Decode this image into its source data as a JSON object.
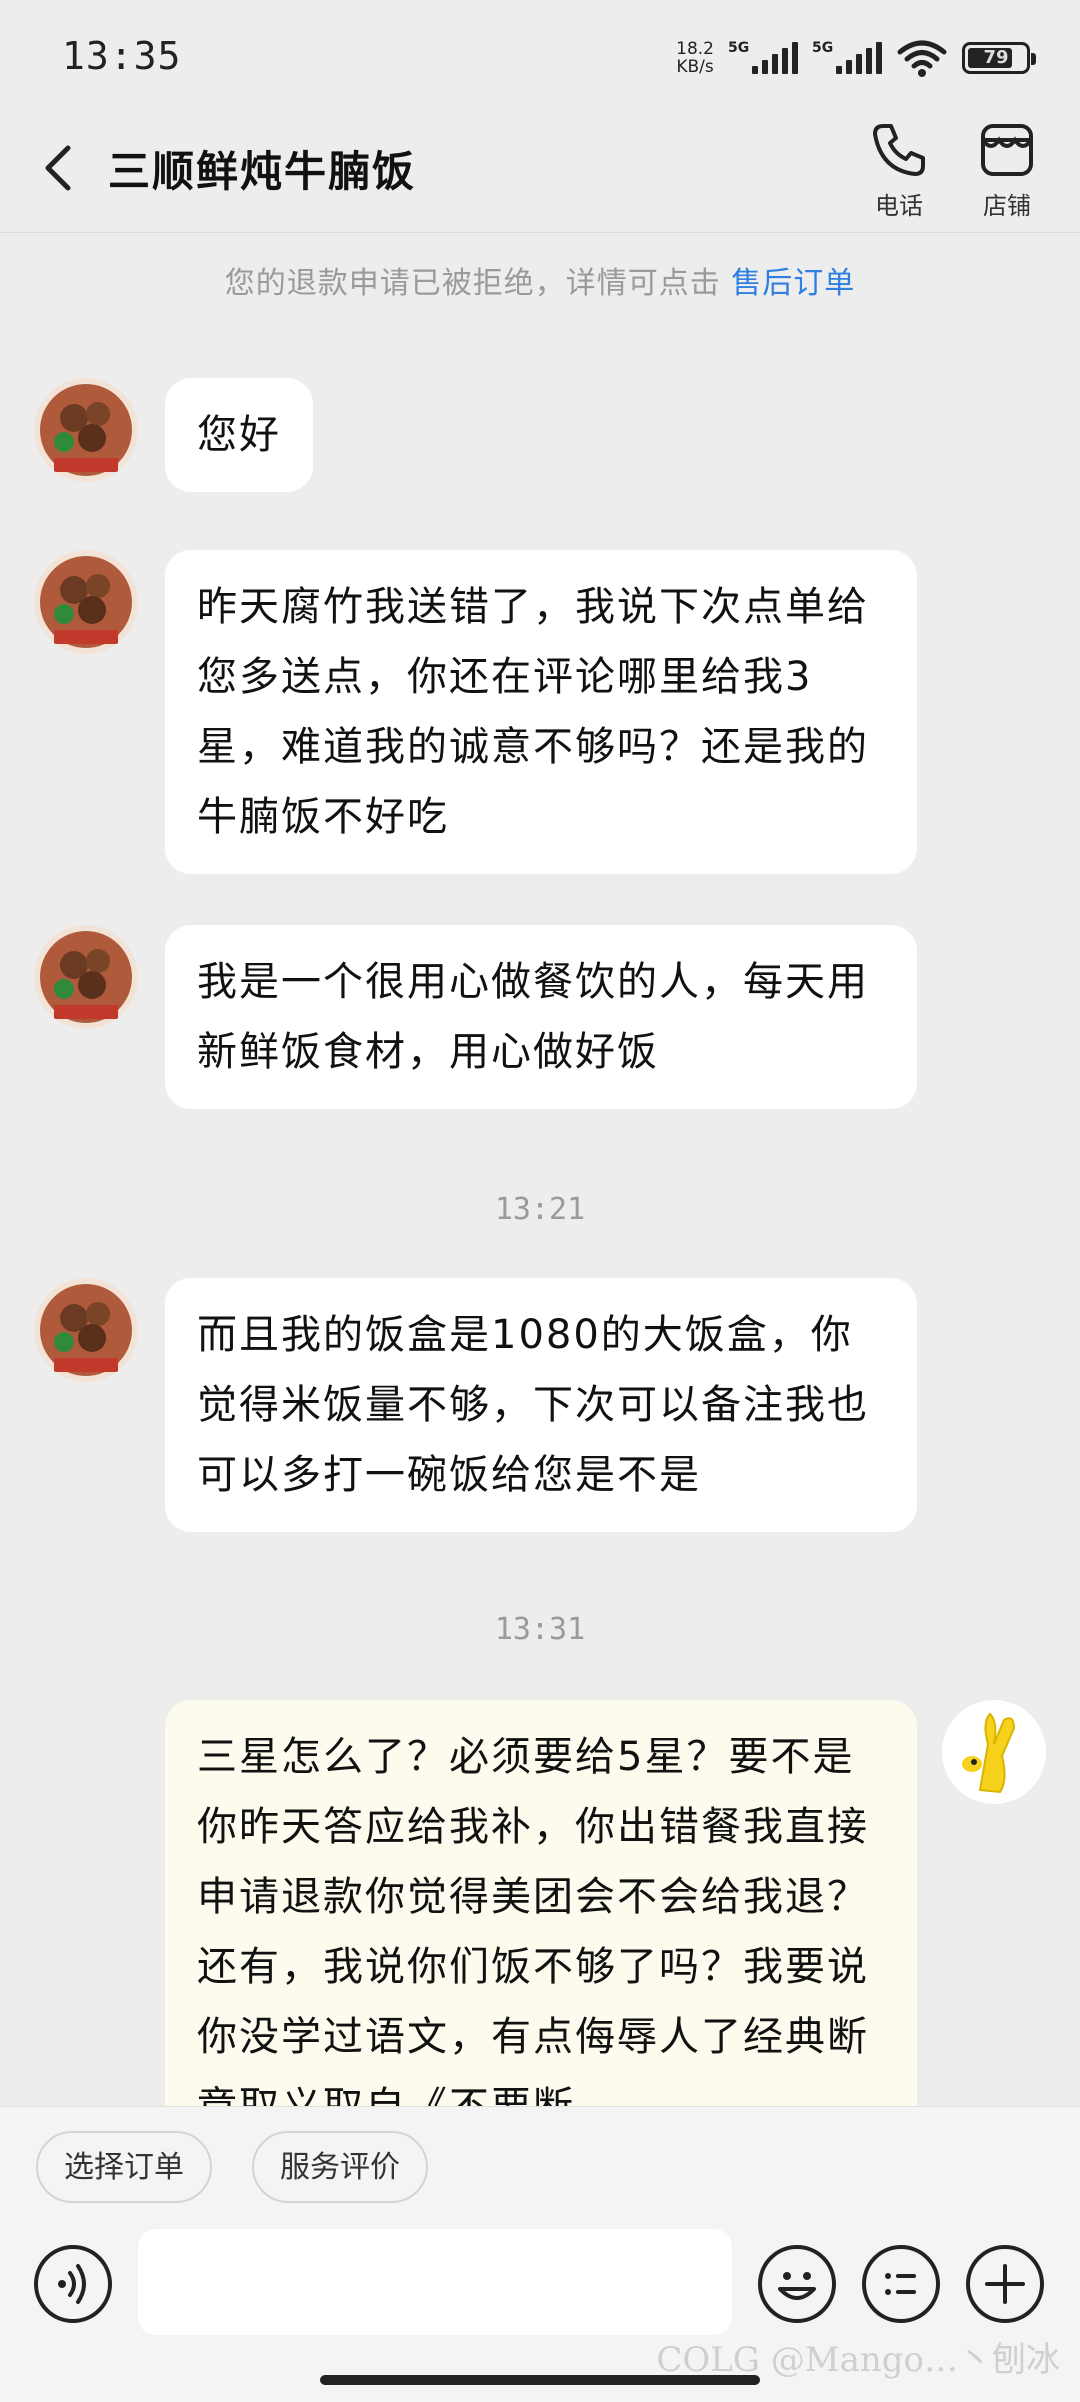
{
  "status_bar": {
    "time": "13:35",
    "net_speed_value": "18.2",
    "net_speed_unit": "KB/s",
    "signal1_label": "5G",
    "signal2_label": "5G",
    "battery": "79"
  },
  "header": {
    "title": "三顺鲜炖牛腩饭",
    "phone_label": "电话",
    "shop_label": "店铺"
  },
  "notice": {
    "text": "您的退款申请已被拒绝，详情可点击 ",
    "link": "售后订单"
  },
  "messages": [
    {
      "from": "shop",
      "text": "您好"
    },
    {
      "from": "shop",
      "text": "昨天腐竹我送错了，我说下次点单给您多送点，你还在评论哪里给我3星，难道我的诚意不够吗？还是我的牛腩饭不好吃"
    },
    {
      "from": "shop",
      "text": "我是一个很用心做餐饮的人，每天用新鲜饭食材，用心做好饭"
    },
    {
      "from": "shop",
      "text": "而且我的饭盒是1080的大饭盒，你觉得米饭量不够，下次可以备注我也可以多打一碗饭给您是不是"
    },
    {
      "from": "me",
      "text": "三星怎么了？必须要给5星？要不是你昨天答应给我补，你出错餐我直接申请退款你觉得美团会不会给我退？还有，我说你们饭不够了吗？我要说你没学过语文，有点侮辱人了经典断章取义取自《不要断"
    }
  ],
  "timestamps": [
    "13:21",
    "13:31"
  ],
  "quick_actions": [
    "选择订单",
    "服务评价"
  ],
  "watermark": "COLG @Mango…丶刨冰",
  "colors": {
    "background": "#ededed",
    "link_blue": "#2f7fe0",
    "my_bubble": "#fdfbee",
    "shop_bubble": "#ffffff"
  }
}
